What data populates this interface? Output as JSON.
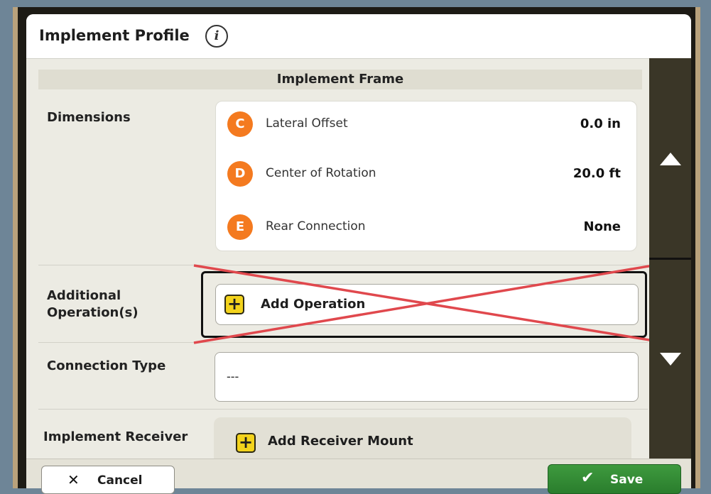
{
  "header": {
    "title": "Implement Profile",
    "info_icon": "i"
  },
  "section": {
    "title": "Implement Frame"
  },
  "dimensions": {
    "label": "Dimensions",
    "items": [
      {
        "letter": "C",
        "label": "Lateral Offset",
        "value": "0.0 in"
      },
      {
        "letter": "D",
        "label": "Center of Rotation",
        "value": "20.0 ft"
      },
      {
        "letter": "E",
        "label": "Rear Connection",
        "value": "None"
      }
    ]
  },
  "additional_operations": {
    "label_line1": "Additional",
    "label_line2": "Operation(s)",
    "button_icon": "+",
    "button_label": "Add Operation"
  },
  "connection_type": {
    "label": "Connection Type",
    "value": "---"
  },
  "implement_receiver": {
    "label": "Implement Receiver",
    "button_icon": "+",
    "button_label": "Add Receiver Mount"
  },
  "footer": {
    "cancel_icon": "✕",
    "cancel_label": "Cancel",
    "save_icon": "✔",
    "save_label": "Save"
  },
  "icons": {
    "info": "info-icon",
    "scroll_up": "triangle-up-icon",
    "scroll_down": "triangle-down-icon",
    "add": "plus-icon",
    "cancel": "x-icon",
    "save": "checkmark-icon"
  },
  "colors": {
    "badge": "#f47a1f",
    "add_button": "#f3d31c",
    "save_button": "#2a7d2d",
    "cross_out": "#e0484d",
    "scrollbar": "#3a3627"
  }
}
